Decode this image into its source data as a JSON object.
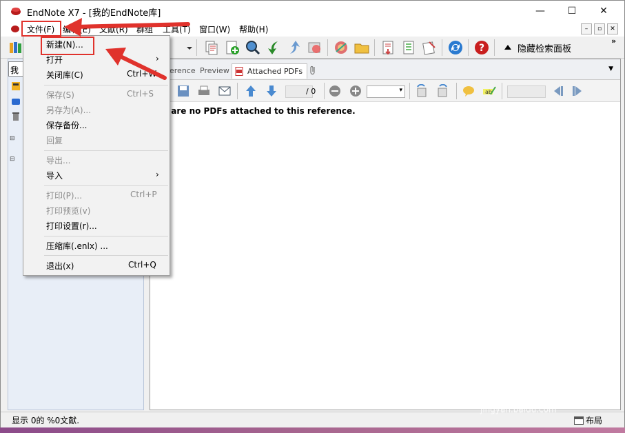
{
  "window": {
    "title": "EndNote X7 - [我的EndNote库]",
    "controls": {
      "minimize": "—",
      "maximize": "☐",
      "close": "✕"
    }
  },
  "menubar": {
    "items": [
      "文件(F)",
      "编辑(E)",
      "文献(R)",
      "群组",
      "工具(T)",
      "窗口(W)",
      "帮助(H)"
    ],
    "mdi": {
      "minimize": "–",
      "restore": "▫",
      "close": "✕"
    }
  },
  "toolbar": {
    "hide_search_panel": "隐藏检索面板",
    "overflow": "»"
  },
  "left_panel": {
    "search_prefix": "我"
  },
  "tabs": {
    "items": [
      "erence",
      "Preview",
      "Attached PDFs"
    ]
  },
  "pdf_toolbar": {
    "page_total": "/ 0"
  },
  "pdf_view": {
    "message": "re are no PDFs attached to this reference."
  },
  "statusbar": {
    "text": "显示 0的 %0文献.",
    "layout": "布局"
  },
  "file_menu": {
    "new": "新建(N)...",
    "open": "打开",
    "close_library": "关闭库(C)",
    "close_library_shortcut": "Ctrl+W",
    "save": "保存(S)",
    "save_shortcut": "Ctrl+S",
    "save_as": "另存为(A)...",
    "save_backup": "保存备份...",
    "revert": "回复",
    "export": "导出...",
    "import": "导入",
    "print": "打印(P)...",
    "print_shortcut": "Ctrl+P",
    "print_preview": "打印预览(v)",
    "print_setup": "打印设置(r)...",
    "compress": "压缩库(.enlx) ...",
    "exit": "退出(x)",
    "exit_shortcut": "Ctrl+Q",
    "submenu_arrow": "›"
  },
  "watermark": {
    "brand": "Bai 经验",
    "url": "jingyan.baidu.com"
  },
  "colors": {
    "annotation_red": "#e0322c",
    "menu_bg": "#f2f2f2",
    "disabled_text": "#8c8c8c"
  }
}
